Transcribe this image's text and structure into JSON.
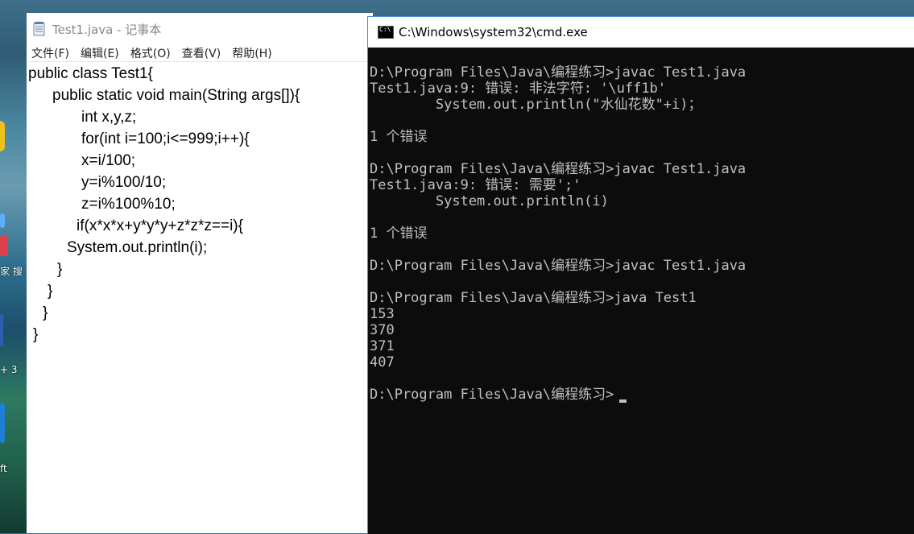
{
  "notepad": {
    "title": "Test1.java - 记事本",
    "menu": [
      "文件(F)",
      "编辑(E)",
      "格式(O)",
      "查看(V)",
      "帮助(H)"
    ],
    "code": [
      "public class Test1{",
      "public static void main(String args[]){",
      "int x,y,z;",
      "for(int i=100;i<=999;i++){",
      "x=i/100;",
      "y=i%100/10;",
      "z=i%100%10;",
      "if(x*x*x+y*y*y+z*z*z==i){",
      "System.out.println(i);",
      "}",
      "}",
      "}",
      "}"
    ]
  },
  "cmd": {
    "title": "C:\\Windows\\system32\\cmd.exe",
    "lines": [
      "D:\\Program Files\\Java\\编程练习>javac Test1.java",
      "Test1.java:9: 错误: 非法字符: '\\uff1b'",
      "        System.out.println(\"水仙花数\"+i)；",
      "",
      "1 个错误",
      "",
      "D:\\Program Files\\Java\\编程练习>javac Test1.java",
      "Test1.java:9: 错误: 需要';'",
      "        System.out.println(i)",
      "",
      "1 个错误",
      "",
      "D:\\Program Files\\Java\\编程练习>javac Test1.java",
      "",
      "D:\\Program Files\\Java\\编程练习>java Test1",
      "153",
      "370",
      "371",
      "407",
      "",
      "D:\\Program Files\\Java\\编程练习>"
    ]
  },
  "desktop": {
    "label_1": "家 搜",
    "label_2": "+ 3",
    "label_3": "ft"
  }
}
